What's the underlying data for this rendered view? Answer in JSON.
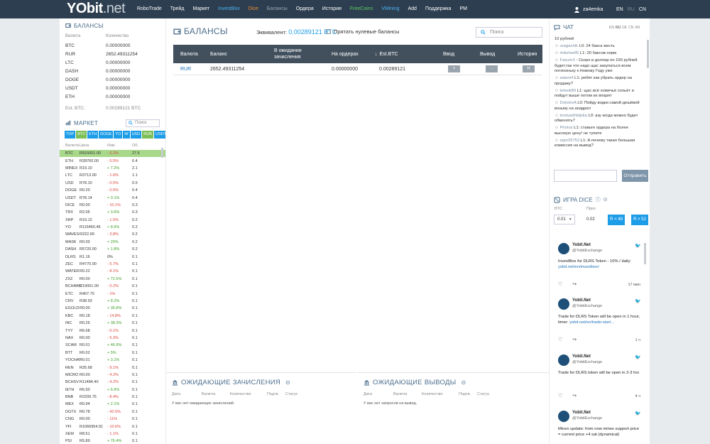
{
  "brand": {
    "logo_main": "YObit",
    "logo_sub": ".net"
  },
  "nav": [
    {
      "label": "RoboTrade",
      "color": "#ffffff"
    },
    {
      "label": "Трейд",
      "color": "#ffffff"
    },
    {
      "label": "Маркет",
      "color": "#ffffff"
    },
    {
      "label": "InvestBox",
      "color": "#4db1f0"
    },
    {
      "label": "Dice",
      "color": "#f0922f"
    },
    {
      "label": "Балансы",
      "color": "#9aa6b2"
    },
    {
      "label": "Ордера",
      "color": "#ffffff"
    },
    {
      "label": "История",
      "color": "#ffffff"
    },
    {
      "label": "FreeCoins",
      "color": "#5fcc62"
    },
    {
      "label": "VMining",
      "color": "#4db1f0"
    },
    {
      "label": "Add",
      "color": "#ffffff"
    },
    {
      "label": "Поддержка",
      "color": "#ffffff"
    },
    {
      "label": "PM",
      "color": "#ffffff"
    }
  ],
  "user": {
    "name": "za4emka"
  },
  "langs": [
    "EN",
    "RU",
    "CN"
  ],
  "balances_side": {
    "title": "БАЛАНСЫ",
    "col_currency": "Валюта",
    "col_amount": "Количество",
    "rows": [
      {
        "cur": "BTC",
        "amt": "0.00000000"
      },
      {
        "cur": "RUR",
        "amt": "2652.49311254"
      },
      {
        "cur": "LTC",
        "amt": "0.00000000"
      },
      {
        "cur": "DASH",
        "amt": "0.00000000"
      },
      {
        "cur": "DOGE",
        "amt": "0.00000000"
      },
      {
        "cur": "USDT",
        "amt": "0.00000000"
      },
      {
        "cur": "ETH",
        "amt": "0.00000000"
      }
    ],
    "est_label": "Est. BTC:",
    "est_value": "0.00289121 BTC"
  },
  "market": {
    "title": "МАРКЕТ",
    "search_placeholder": "Поиск",
    "tabs": [
      "TOP",
      "BTC",
      "ETH",
      "DOGE",
      "YO",
      "W",
      "USD",
      "RUR",
      "USDT"
    ],
    "col_currency": "Валюта",
    "col_price": "Цена",
    "col_change": "Изм.",
    "col_volume": "Об.",
    "rows": [
      {
        "c": "BTC",
        "p": "R915001.00",
        "ch": "- 0.2%",
        "v": "27.6",
        "dir": "dn"
      },
      {
        "c": "ETH",
        "p": "R28760.00",
        "ch": "- 5.5%",
        "v": "6.4",
        "dir": "dn"
      },
      {
        "c": "MINEX",
        "p": "R19.10",
        "ch": "+ 7.2%",
        "v": "2.1",
        "dir": "up"
      },
      {
        "c": "LTC",
        "p": "R3713.00",
        "ch": "- 1.6%",
        "v": "1.1",
        "dir": "dn"
      },
      {
        "c": "USD",
        "p": "R78.10",
        "ch": "- 0.5%",
        "v": "0.5",
        "dir": "dn"
      },
      {
        "c": "DOGE",
        "p": "R0.20",
        "ch": "- 0.6%",
        "v": "0.4",
        "dir": "dn"
      },
      {
        "c": "USDT",
        "p": "R78.14",
        "ch": "+ 0.1%",
        "v": "0.4",
        "dir": "up"
      },
      {
        "c": "DICE",
        "p": "R0.00",
        "ch": "- 10.1%",
        "v": "0.3",
        "dir": "dn"
      },
      {
        "c": "TRX",
        "p": "R2.05",
        "ch": "+ 0.6%",
        "v": "0.3",
        "dir": "up"
      },
      {
        "c": "XRP",
        "p": "R19.12",
        "ch": "- 1.5%",
        "v": "0.2",
        "dir": "dn"
      },
      {
        "c": "YO",
        "p": "R115460.46",
        "ch": "+ 8.6%",
        "v": "0.2",
        "dir": "up"
      },
      {
        "c": "WAVES",
        "p": "R222.99",
        "ch": "- 3.8%",
        "v": "0.2",
        "dir": "dn"
      },
      {
        "c": "MASK",
        "p": "R0.00",
        "ch": "+ 20%",
        "v": "0.2",
        "dir": "up"
      },
      {
        "c": "DASH",
        "p": "R5720.00",
        "ch": "+ 1.8%",
        "v": "0.2",
        "dir": "up"
      },
      {
        "c": "DLRS",
        "p": "R1.16",
        "ch": "0%",
        "v": "0.1",
        "dir": "nc"
      },
      {
        "c": "ZEC",
        "p": "R4770.00",
        "ch": "- 5.7%",
        "v": "0.1",
        "dir": "dn"
      },
      {
        "c": "WATER",
        "p": "R0.22",
        "ch": "- 8.1%",
        "v": "0.1",
        "dir": "dn"
      },
      {
        "c": "ZXZ",
        "p": "R0.00",
        "ch": "+ 72.5%",
        "v": "0.1",
        "dir": "up"
      },
      {
        "c": "BCHABC",
        "p": "R19001.00",
        "ch": "- 0.2%",
        "v": "0.1",
        "dir": "dn"
      },
      {
        "c": "ETC",
        "p": "R407.75",
        "ch": "- 1%",
        "v": "0.1",
        "dir": "dn"
      },
      {
        "c": "CRV",
        "p": "R38.93",
        "ch": "+ 8.2%",
        "v": "0.1",
        "dir": "up"
      },
      {
        "c": "EGOLD",
        "p": "R0.00",
        "ch": "+ 35.8%",
        "v": "0.1",
        "dir": "up"
      },
      {
        "c": "KBC",
        "p": "R0.18",
        "ch": "- 14.8%",
        "v": "0.1",
        "dir": "dn"
      },
      {
        "c": "INC",
        "p": "R0.25",
        "ch": "+ 38.3%",
        "v": "0.1",
        "dir": "up"
      },
      {
        "c": "TYY",
        "p": "R6.68",
        "ch": "- 0.1%",
        "v": "0.1",
        "dir": "dn"
      },
      {
        "c": "NAX",
        "p": "R0.00",
        "ch": "- 5.3%",
        "v": "0.1",
        "dir": "dn"
      },
      {
        "c": "SCAM",
        "p": "R0.01",
        "ch": "+ 46.9%",
        "v": "0.1",
        "dir": "up"
      },
      {
        "c": "BTT",
        "p": "R0.02",
        "ch": "+ 5%",
        "v": "0.1",
        "dir": "up"
      },
      {
        "c": "YOCHAT",
        "p": "R0.01",
        "ch": "+ 3.1%",
        "v": "0.1",
        "dir": "up"
      },
      {
        "c": "REN",
        "p": "R25.68",
        "ch": "- 9.1%",
        "v": "0.1",
        "dir": "dn"
      },
      {
        "c": "MICRO",
        "p": "R0.00",
        "ch": "- 4.2%",
        "v": "0.1",
        "dir": "dn"
      },
      {
        "c": "BCHSV",
        "p": "R11484.40",
        "ch": "- 4.2%",
        "v": "0.1",
        "dir": "dn"
      },
      {
        "c": "IETH",
        "p": "R6.50",
        "ch": "+ 6.6%",
        "v": "0.1",
        "dir": "up"
      },
      {
        "c": "BNB",
        "p": "R2209.75",
        "ch": "- 8.4%",
        "v": "0.1",
        "dir": "dn"
      },
      {
        "c": "MEX",
        "p": "R0.94",
        "ch": "+ 2.1%",
        "v": "0.1",
        "dir": "up"
      },
      {
        "c": "DGTX",
        "p": "R0.78",
        "ch": "- 42.5%",
        "v": "0.1",
        "dir": "dn"
      },
      {
        "c": "CNG",
        "p": "R0.00",
        "ch": "- 11%",
        "v": "0.1",
        "dir": "dn"
      },
      {
        "c": "YFI",
        "p": "R1066954.91",
        "ch": "- 10.6%",
        "v": "0.1",
        "dir": "dn"
      },
      {
        "c": "XEM",
        "p": "R8.51",
        "ch": "- 1.1%",
        "v": "0.1",
        "dir": "dn"
      },
      {
        "c": "PSI",
        "p": "R5.89",
        "ch": "+ 76.4%",
        "v": "0.1",
        "dir": "up"
      }
    ]
  },
  "balances_main": {
    "title": "БАЛАНСЫ",
    "equiv_label": "Эквивалент:",
    "equiv_value": "0.00289121 BTC",
    "hide_zero_label": "Прятать нулевые балансы",
    "search_placeholder": "Поиск",
    "columns": [
      "Валюта",
      "Баланс",
      "В ожидании зачисления",
      "На ордерах",
      "Est.BTC",
      "Ввод",
      "Вывод",
      "История"
    ],
    "row": {
      "currency": "RUR",
      "balance": "2652.49311254",
      "pending": "",
      "orders": "0.00000000",
      "est_btc": "0.00289121",
      "deposit": "+",
      "withdraw": "-",
      "history": "H"
    }
  },
  "pending_deposits": {
    "title": "ОЖИДАЮЩИЕ ЗАЧИСЛЕНИЯ",
    "cols": [
      "Дата",
      "Валюта",
      "Количество",
      "Подтв.",
      "Статус"
    ],
    "empty": "У вас нет ожидающих зачислений."
  },
  "pending_withdrawals": {
    "title": "ОЖИДАЮЩИЕ ВЫВОДЫ",
    "cols": [
      "Дата",
      "Валюта",
      "Количество",
      "Подтв.",
      "Статус"
    ],
    "empty": "У вас нет запросов на вывод."
  },
  "chat": {
    "title": "ЧАТ",
    "langs": [
      "EN",
      "RU",
      "DE",
      "CN",
      "AR"
    ],
    "messages": [
      {
        "user": "",
        "text": "10 рублей"
      },
      {
        "user": "uraganhik",
        "text": "L0: 24 бакса жесть"
      },
      {
        "user": "mikshar85",
        "text": "L1: 20 баксов норм"
      },
      {
        "user": "FasumX",
        "text": ": Скоро и доллар по 100 рублей будет,так что надо щас закупаться всем потихоньку к Новому Году уже"
      },
      {
        "user": "adami4",
        "text": "L1: ребят как убрать ордер на продажу?"
      },
      {
        "user": "keksik89",
        "text": "L1: щас всё хомячьё сольёт и пойдут выше потом их впарят"
      },
      {
        "user": "DolotovA",
        "text": "L0: Пойду водки самой дешёвой возьму на ахидрол"
      },
      {
        "user": "kostyadhtdjska",
        "text": "L0: азу когда можно будет обменять?"
      },
      {
        "user": "Photos",
        "text": "L1: ставьте ордера на более высокую цену! не тупите"
      },
      {
        "user": "egor25753",
        "text": "L1: А почему такая большая комиссия на вывод?"
      }
    ],
    "send_label": "Отправить"
  },
  "dice": {
    "title": "ИГРА DICE",
    "lbl_currency": "BTC",
    "lbl_bet": "Приз",
    "bet_select": "0.01",
    "prize": "0.02",
    "btn_low": "R < 48",
    "btn_high": "R > 52"
  },
  "tweets": [
    {
      "name": "Yobit.Net",
      "handle": "@YobitExchange",
      "text": "InvestBox for DLRS Token - 10% / daily:",
      "link": "yobit.net/en/investbox/",
      "time": "17 мин"
    },
    {
      "name": "Yobit.Net",
      "handle": "@YobitExchange",
      "text": "Trade for DLRS Token will be open in 1 hour, timer:",
      "link": "yobit.net/en/trade-start…",
      "time": "1 ч"
    },
    {
      "name": "Yobit.Net",
      "handle": "@YobitExchange",
      "text": "Trade for DLRS token will be open in 2-3 hrs",
      "link": "",
      "time": "4 ч"
    },
    {
      "name": "Yobit.Net",
      "handle": "@YobitExchange",
      "text": "Minex update: from now minex support price = current price +4 sat (dynamical)",
      "link": "",
      "time": ""
    }
  ]
}
